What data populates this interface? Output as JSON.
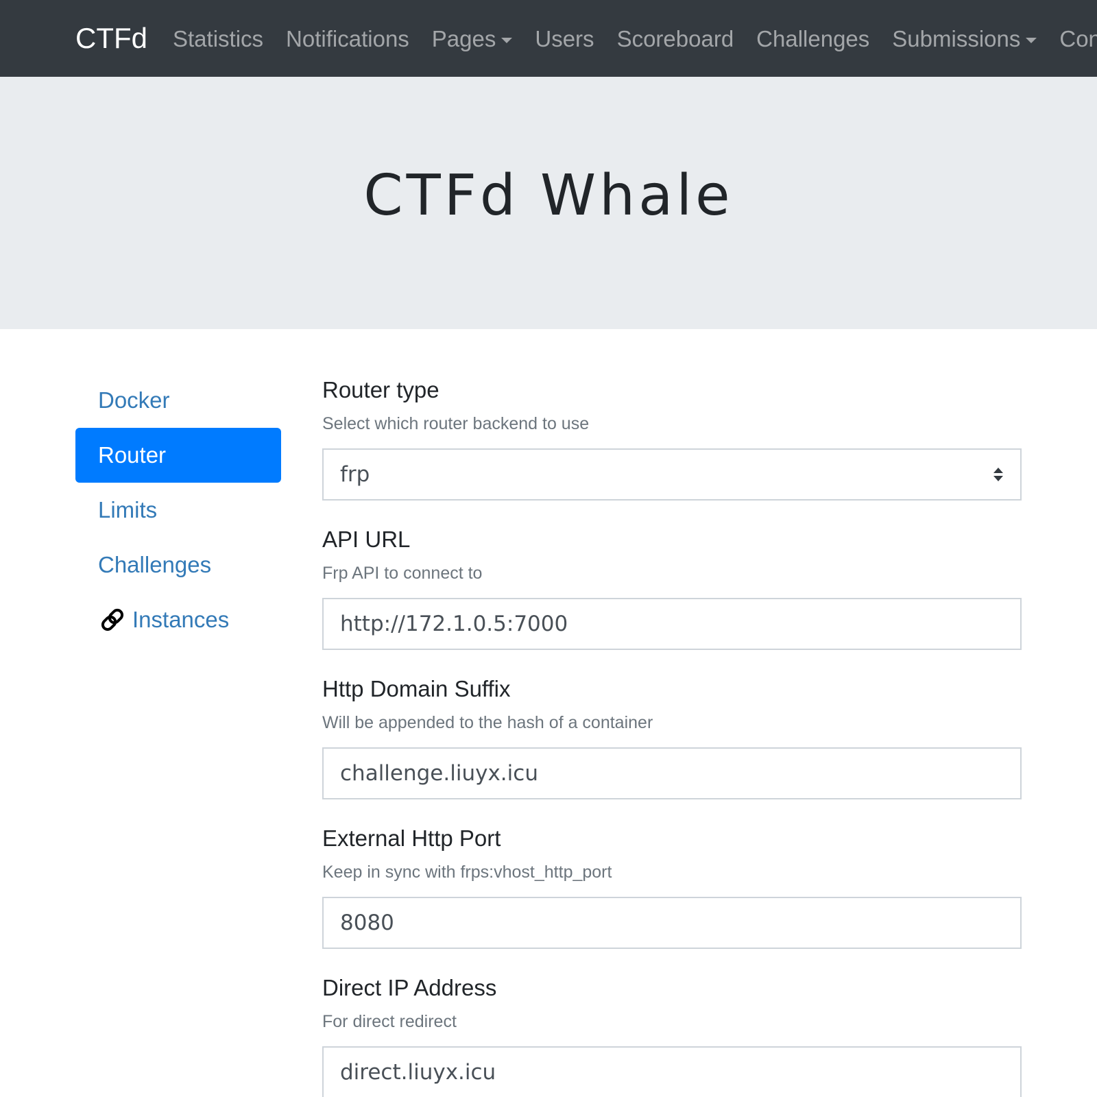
{
  "brand": "CTFd",
  "nav": {
    "items": [
      {
        "label": "Statistics",
        "dropdown": false
      },
      {
        "label": "Notifications",
        "dropdown": false
      },
      {
        "label": "Pages",
        "dropdown": true
      },
      {
        "label": "Users",
        "dropdown": false
      },
      {
        "label": "Scoreboard",
        "dropdown": false
      },
      {
        "label": "Challenges",
        "dropdown": false
      },
      {
        "label": "Submissions",
        "dropdown": true
      },
      {
        "label": "Config",
        "dropdown": false
      }
    ]
  },
  "jumbotron": {
    "title": "CTFd Whale"
  },
  "sidebar": {
    "items": [
      {
        "label": "Docker"
      },
      {
        "label": "Router",
        "active": true
      },
      {
        "label": "Limits"
      },
      {
        "label": "Challenges"
      },
      {
        "label": "Instances",
        "icon": "link-icon"
      }
    ]
  },
  "form": {
    "router_type": {
      "label": "Router type",
      "help": "Select which router backend to use",
      "value": "frp"
    },
    "api_url": {
      "label": "API URL",
      "help": "Frp API to connect to",
      "value": "http://172.1.0.5:7000"
    },
    "http_domain_suffix": {
      "label": "Http Domain Suffix",
      "help": "Will be appended to the hash of a container",
      "value": "challenge.liuyx.icu"
    },
    "external_http_port": {
      "label": "External Http Port",
      "help": "Keep in sync with frps:vhost_http_port",
      "value": "8080"
    },
    "direct_ip": {
      "label": "Direct IP Address",
      "help": "For direct redirect",
      "value": "direct.liuyx.icu"
    }
  },
  "colors": {
    "navbar": "#343a40",
    "jumbotron": "#e9ecef",
    "active": "#007bff",
    "link": "#337ab7"
  }
}
